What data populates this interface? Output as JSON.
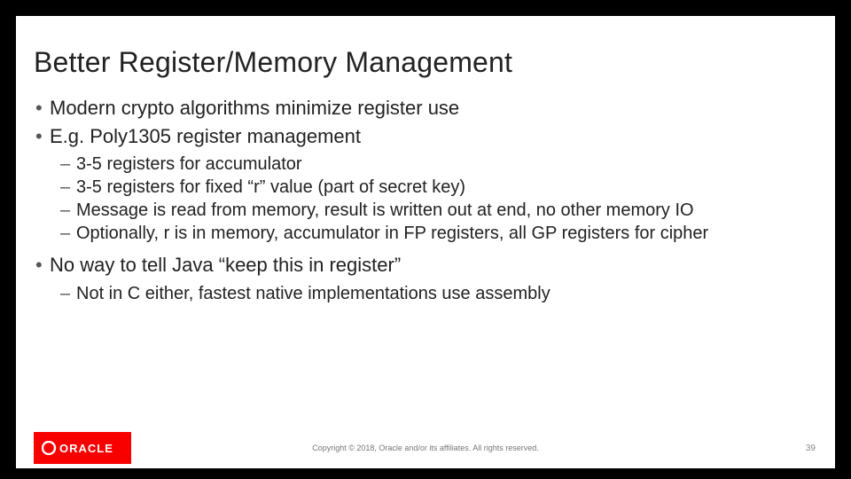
{
  "title": "Better Register/Memory Management",
  "bullets": [
    {
      "text": "Modern crypto algorithms minimize register use",
      "sub": []
    },
    {
      "text": "E.g. Poly1305 register management",
      "sub": [
        "3-5 registers for accumulator",
        "3-5 registers for fixed “r” value (part of secret key)",
        "Message is read from memory, result is written out at end, no other memory IO",
        "Optionally, r is in memory, accumulator in FP registers, all GP registers for cipher"
      ]
    },
    {
      "text": "No way to tell Java “keep this in register”",
      "sub": [
        "Not in C either, fastest native implementations use assembly"
      ]
    }
  ],
  "footer": {
    "logo_name": "ORACLE",
    "copyright": "Copyright © 2018, Oracle and/or its affiliates. All rights reserved.",
    "page_number": "39"
  },
  "colors": {
    "oracle_red": "#f80000"
  }
}
